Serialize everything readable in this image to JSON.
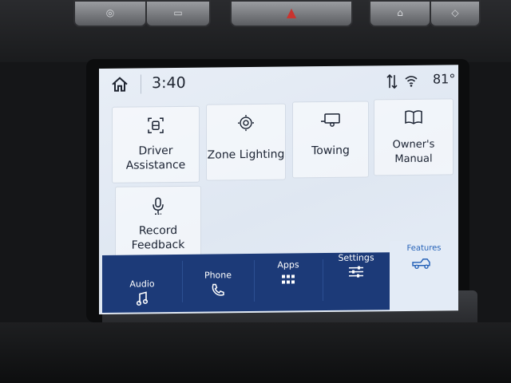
{
  "status": {
    "time": "3:40",
    "temperature": "81°",
    "icons": [
      "home-icon",
      "signal-icon",
      "wifi-icon"
    ]
  },
  "tiles": [
    {
      "label_line1": "Driver",
      "label_line2": "Assistance",
      "icon": "driver-assist-icon"
    },
    {
      "label": "Zone Lighting",
      "icon": "zone-lighting-icon"
    },
    {
      "label": "Towing",
      "icon": "trailer-icon"
    },
    {
      "label": "Owner's Manual",
      "icon": "manual-book-icon"
    },
    {
      "label_line1": "Record",
      "label_line2": "Feedback",
      "icon": "microphone-icon"
    }
  ],
  "nav": {
    "audio": "Audio",
    "phone": "Phone",
    "apps": "Apps",
    "settings": "Settings",
    "features": "Features"
  },
  "colors": {
    "nav_background": "#1c3a78",
    "features_accent": "#2763b8",
    "screen_background": "#e2e9f3"
  }
}
